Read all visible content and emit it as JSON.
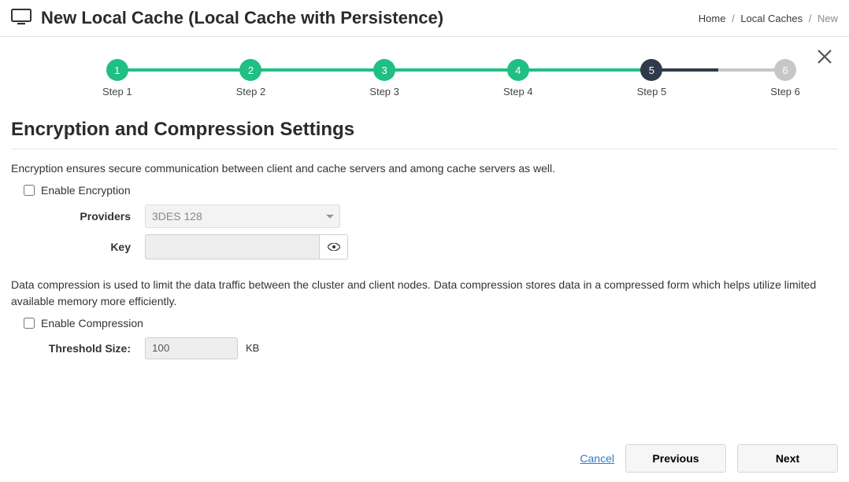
{
  "header": {
    "title": "New Local Cache (Local Cache with Persistence)"
  },
  "breadcrumb": {
    "home": "Home",
    "mid": "Local Caches",
    "current": "New"
  },
  "steps": {
    "labels": [
      "Step 1",
      "Step 2",
      "Step 3",
      "Step 4",
      "Step 5",
      "Step 6"
    ],
    "nums": [
      "1",
      "2",
      "3",
      "4",
      "5",
      "6"
    ],
    "colors": {
      "done": "#20bf84",
      "current": "#2f3a4a",
      "future": "#c7c7c7"
    }
  },
  "section": {
    "title": "Encryption and Compression Settings",
    "enc_desc": "Encryption ensures secure communication between client and cache servers and among cache servers as well.",
    "enable_enc": "Enable Encryption",
    "providers_label": "Providers",
    "providers_value": "3DES 128",
    "key_label": "Key",
    "comp_desc": "Data compression is used to limit the data traffic between the cluster and client nodes. Data compression stores data in a compressed form which helps utilize limited available memory more efficiently.",
    "enable_comp": "Enable Compression",
    "threshold_label": "Threshold Size:",
    "threshold_value": "100",
    "threshold_unit": "KB"
  },
  "footer": {
    "cancel": "Cancel",
    "previous": "Previous",
    "next": "Next"
  }
}
